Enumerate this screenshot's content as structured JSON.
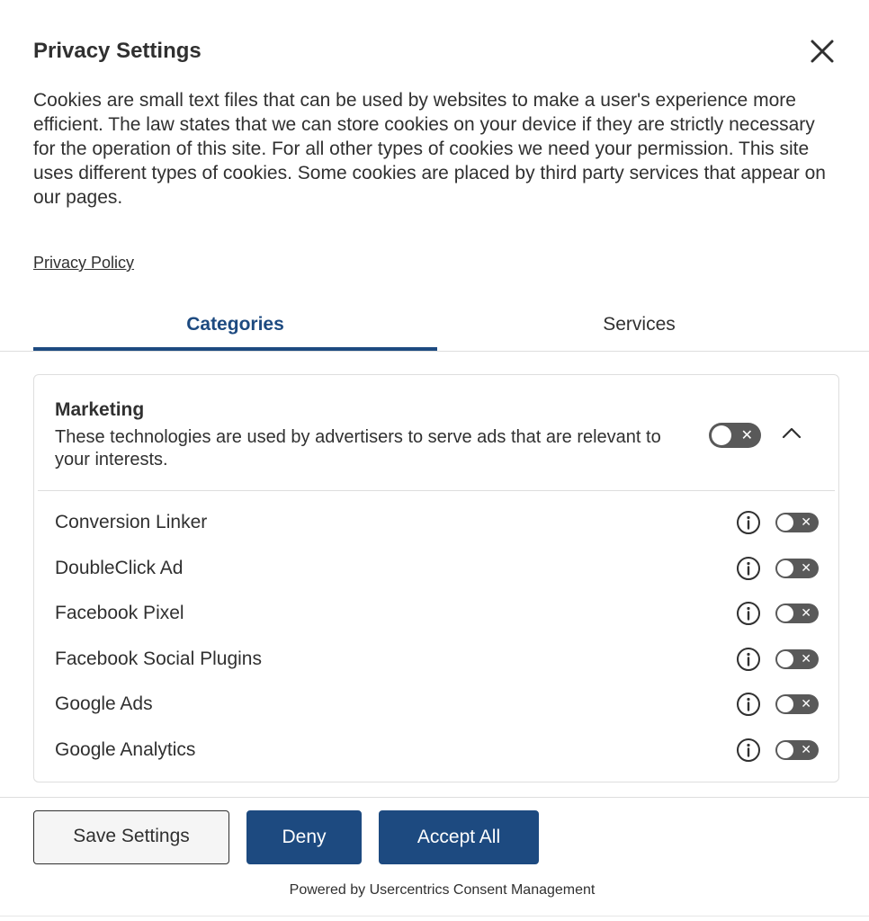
{
  "dialog": {
    "title": "Privacy Settings",
    "description": "Cookies are small text files that can be used by websites to make a user's experience more efficient. The law states that we can store cookies on your device if they are strictly necessary for the operation of this site. For all other types of cookies we need your permission. This site uses different types of cookies. Some cookies are placed by third party services that appear on our pages.",
    "privacy_policy_link": "Privacy Policy"
  },
  "tabs": [
    {
      "label": "Categories",
      "active": true
    },
    {
      "label": "Services",
      "active": false
    }
  ],
  "category": {
    "title": "Marketing",
    "description": "These technologies are used by advertisers to serve ads that are relevant to your interests.",
    "enabled": false,
    "expanded": true,
    "toggle_symbol": "✕",
    "services": [
      {
        "name": "Conversion Linker",
        "enabled": false
      },
      {
        "name": "DoubleClick Ad",
        "enabled": false
      },
      {
        "name": "Facebook Pixel",
        "enabled": false
      },
      {
        "name": "Facebook Social Plugins",
        "enabled": false
      },
      {
        "name": "Google Ads",
        "enabled": false
      },
      {
        "name": "Google Analytics",
        "enabled": false
      }
    ]
  },
  "footer": {
    "save_label": "Save Settings",
    "deny_label": "Deny",
    "accept_label": "Accept All",
    "powered_by": "Powered by Usercentrics Consent Management"
  },
  "colors": {
    "accent": "#1d4a80",
    "text": "#303030",
    "toggle_off": "#595959",
    "border": "#dedede"
  }
}
